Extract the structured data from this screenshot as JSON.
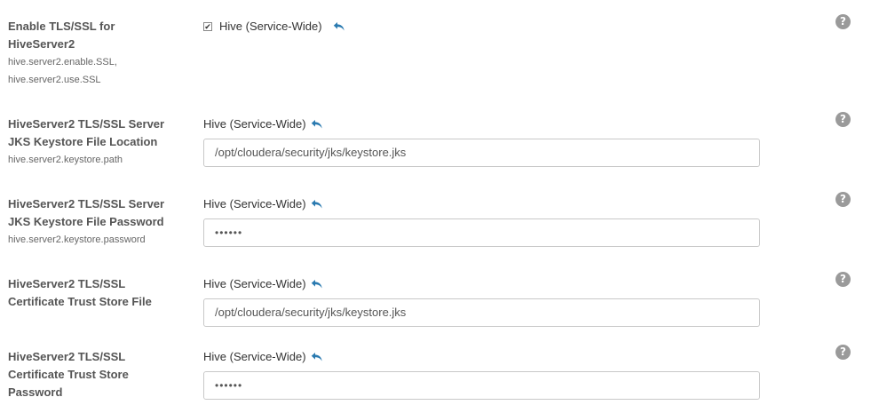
{
  "settings": [
    {
      "title_lines": [
        "Enable TLS/SSL for",
        "HiveServer2"
      ],
      "keys": [
        "hive.server2.enable.SSL,",
        "hive.server2.use.SSL"
      ],
      "scope": "Hive (Service-Wide)",
      "type": "checkbox",
      "checked": true
    },
    {
      "title_lines": [
        "HiveServer2 TLS/SSL Server",
        "JKS Keystore File Location"
      ],
      "keys": [
        "hive.server2.keystore.path"
      ],
      "scope": "Hive (Service-Wide)",
      "type": "text",
      "value": "/opt/cloudera/security/jks/keystore.jks"
    },
    {
      "title_lines": [
        "HiveServer2 TLS/SSL Server",
        "JKS Keystore File Password"
      ],
      "keys": [
        "hive.server2.keystore.password"
      ],
      "scope": "Hive (Service-Wide)",
      "type": "password",
      "value": "••••••"
    },
    {
      "title_lines": [
        "HiveServer2 TLS/SSL",
        "Certificate Trust Store File"
      ],
      "keys": [],
      "scope": "Hive (Service-Wide)",
      "type": "text",
      "value": "/opt/cloudera/security/jks/keystore.jks"
    },
    {
      "title_lines": [
        "HiveServer2 TLS/SSL",
        "Certificate Trust Store",
        "Password"
      ],
      "keys": [],
      "scope": "Hive (Service-Wide)",
      "type": "password",
      "value": "••••••"
    }
  ],
  "icons": {
    "undo": "undo-arrow-icon",
    "help": "question-circle-icon",
    "help_glyph": "?"
  },
  "colors": {
    "undo_accent": "#2a7ab0",
    "help_bg": "#9a9a9a"
  }
}
